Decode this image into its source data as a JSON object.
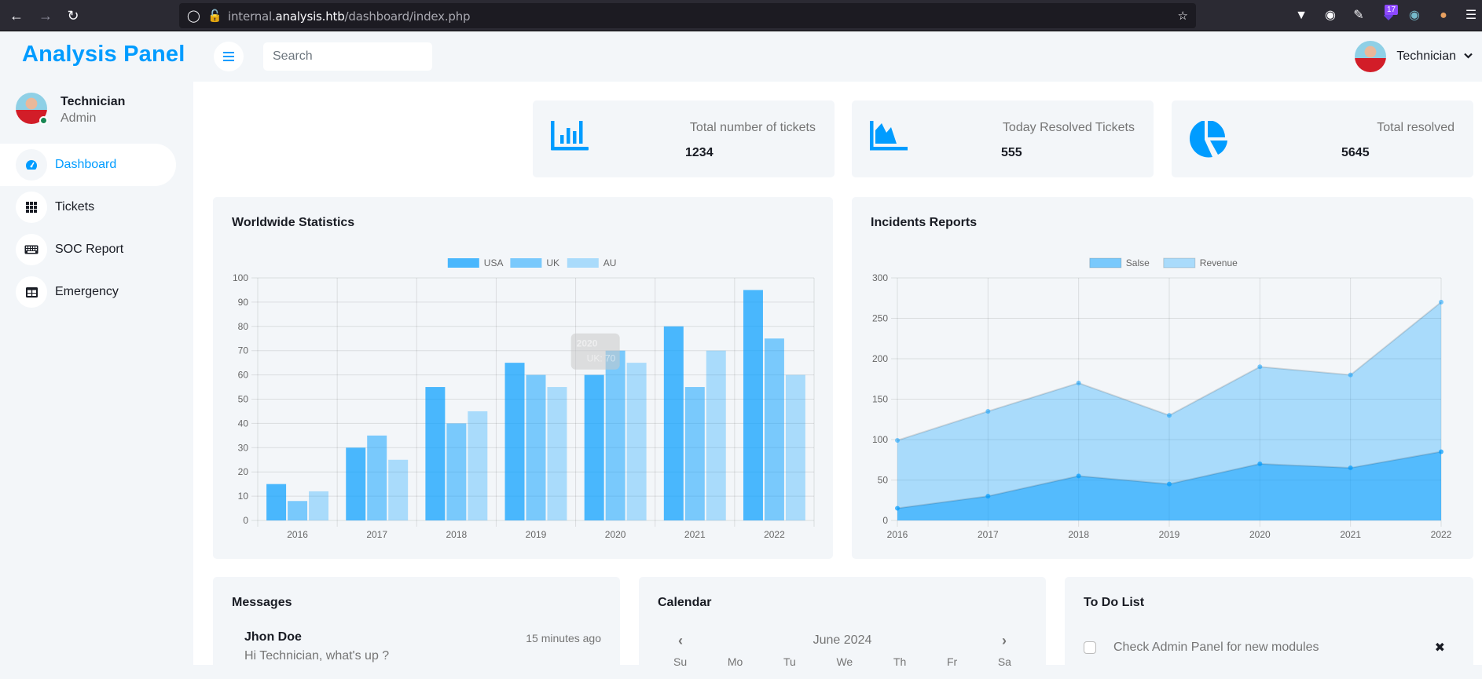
{
  "browser": {
    "url_prefix": "internal.",
    "url_domain": "analysis.htb",
    "url_path": "/dashboard/index.php",
    "extensions_badge": "17"
  },
  "app": {
    "brand": "Analysis Panel",
    "accent_color": "#009cff"
  },
  "profile": {
    "name": "Technician",
    "role": "Admin",
    "status": "online"
  },
  "sidebar": {
    "items": [
      {
        "label": "Dashboard",
        "icon": "tachometer-icon",
        "active": true
      },
      {
        "label": "Tickets",
        "icon": "grid-icon",
        "active": false
      },
      {
        "label": "SOC Report",
        "icon": "keyboard-icon",
        "active": false
      },
      {
        "label": "Emergency",
        "icon": "table-icon",
        "active": false
      }
    ]
  },
  "topbar": {
    "search_placeholder": "Search",
    "search_value": "",
    "user_name": "Technician"
  },
  "stats": [
    {
      "label": "Total number of tickets",
      "value": "1234",
      "icon": "bar-chart-icon"
    },
    {
      "label": "Today Resolved Tickets",
      "value": "555",
      "icon": "area-chart-icon"
    },
    {
      "label": "Total resolved",
      "value": "5645",
      "icon": "pie-chart-icon"
    }
  ],
  "panels": {
    "worldwide_title": "Worldwide Statistics",
    "incidents_title": "Incidents Reports",
    "messages_title": "Messages",
    "calendar_title": "Calendar",
    "todo_title": "To Do List"
  },
  "chart_data": [
    {
      "type": "bar",
      "title": "Worldwide Statistics",
      "categories": [
        "2016",
        "2017",
        "2018",
        "2019",
        "2020",
        "2021",
        "2022"
      ],
      "series": [
        {
          "name": "USA",
          "values": [
            15,
            30,
            55,
            65,
            60,
            80,
            95
          ],
          "color": "#009cff",
          "opacity": 0.7
        },
        {
          "name": "UK",
          "values": [
            8,
            35,
            40,
            60,
            70,
            55,
            75
          ],
          "color": "#009cff",
          "opacity": 0.5
        },
        {
          "name": "AU",
          "values": [
            12,
            25,
            45,
            55,
            65,
            70,
            60
          ],
          "color": "#009cff",
          "opacity": 0.3
        }
      ],
      "yticks": [
        0,
        10,
        20,
        30,
        40,
        50,
        60,
        70,
        80,
        90,
        100
      ],
      "ylim": [
        0,
        100
      ],
      "legend": "top-center",
      "grid": true,
      "tooltip": {
        "title": "2020",
        "label": "UK: 70"
      }
    },
    {
      "type": "area",
      "title": "Incidents Reports",
      "categories": [
        "2016",
        "2017",
        "2018",
        "2019",
        "2020",
        "2021",
        "2022"
      ],
      "series": [
        {
          "name": "Salse",
          "values": [
            15,
            30,
            55,
            45,
            70,
            65,
            85
          ],
          "color": "#009cff",
          "opacity": 0.5
        },
        {
          "name": "Revenue",
          "values": [
            99,
            135,
            170,
            130,
            190,
            180,
            270
          ],
          "color": "#009cff",
          "opacity": 0.3
        }
      ],
      "yticks": [
        0,
        50,
        100,
        150,
        200,
        250,
        300
      ],
      "ylim": [
        0,
        300
      ],
      "legend": "top-center",
      "grid": true
    }
  ],
  "messages": [
    {
      "name": "Jhon Doe",
      "time": "15 minutes ago",
      "text": "Hi Technician, what's up ?"
    }
  ],
  "calendar": {
    "month": "June 2024",
    "weekdays": [
      "Su",
      "Mo",
      "Tu",
      "We",
      "Th",
      "Fr",
      "Sa"
    ]
  },
  "todo": [
    {
      "text": "Check Admin Panel for new modules",
      "done": false
    }
  ]
}
